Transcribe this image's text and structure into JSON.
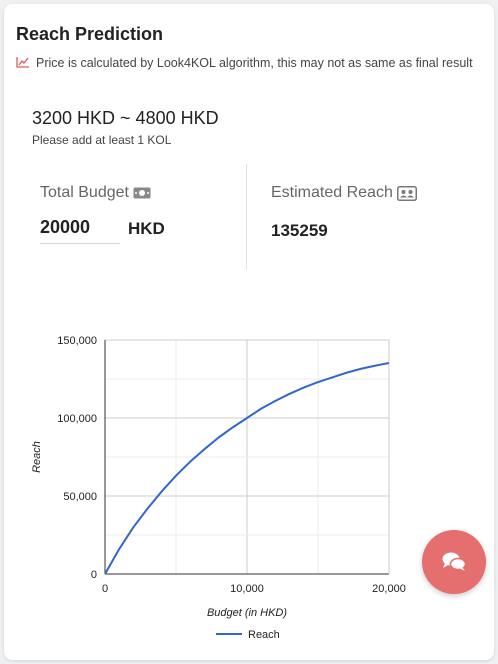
{
  "header": {
    "title": "Reach Prediction"
  },
  "disclaimer": {
    "text": "Price is calculated by Look4KOL algorithm, this may not as same as final result",
    "icon": "trend-line-icon",
    "icon_color": "#e05a5a"
  },
  "price": {
    "range": "3200 HKD ~ 4800 HKD",
    "note": "Please add at least 1 KOL"
  },
  "budget": {
    "label": "Total Budget",
    "icon": "money-bill-icon",
    "value": "20000",
    "unit": "HKD"
  },
  "reach": {
    "label": "Estimated Reach",
    "icon": "users-card-icon",
    "value": "135259"
  },
  "chart_data": {
    "type": "line",
    "xlabel": "Budget (in HKD)",
    "ylabel": "Reach",
    "xlim": [
      0,
      20000
    ],
    "ylim": [
      0,
      150000
    ],
    "x_ticks": [
      "0",
      "10,000",
      "20,000"
    ],
    "y_ticks": [
      "0",
      "50,000",
      "100,000",
      "150,000"
    ],
    "grid": true,
    "legend_position": "bottom",
    "series": [
      {
        "name": "Reach",
        "color": "#3366cc",
        "x": [
          0,
          1000,
          2000,
          3000,
          4000,
          5000,
          6000,
          7000,
          8000,
          9000,
          10000,
          11000,
          12000,
          13000,
          14000,
          15000,
          16000,
          17000,
          18000,
          19000,
          20000
        ],
        "y": [
          0,
          16000,
          30000,
          42000,
          53000,
          63000,
          72000,
          80000,
          87500,
          94000,
          100000,
          106000,
          111000,
          115500,
          119500,
          123000,
          126000,
          129000,
          131500,
          133500,
          135259
        ]
      }
    ]
  },
  "chat": {
    "icon": "chat-bubbles-icon",
    "color": "#e56e6e"
  }
}
